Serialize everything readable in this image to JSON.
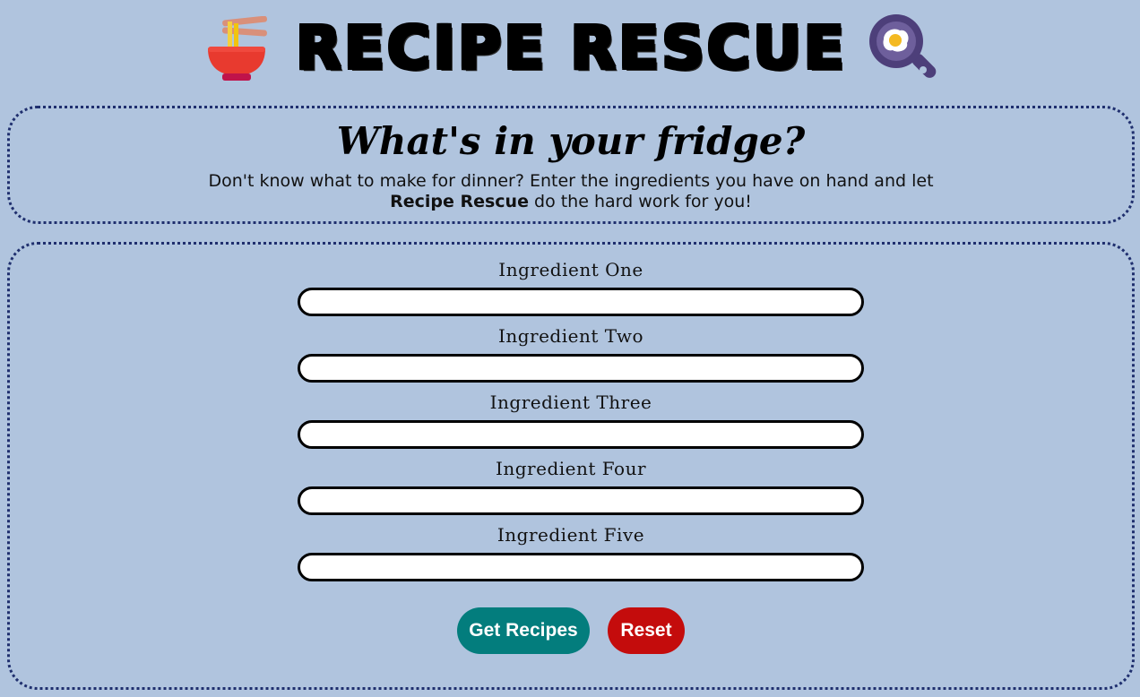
{
  "header": {
    "title": "RECIPE RESCUE",
    "left_icon": "noodle-bowl-icon",
    "right_icon": "frying-pan-egg-icon"
  },
  "intro": {
    "heading": "What's in your fridge?",
    "text_before": "Don't know what to make for dinner? Enter the ingredients you have on hand and let ",
    "brand": "Recipe Rescue",
    "text_after": " do the hard work for you!"
  },
  "form": {
    "fields": [
      {
        "label": "Ingredient One",
        "value": ""
      },
      {
        "label": "Ingredient Two",
        "value": ""
      },
      {
        "label": "Ingredient Three",
        "value": ""
      },
      {
        "label": "Ingredient Four",
        "value": ""
      },
      {
        "label": "Ingredient Five",
        "value": ""
      }
    ],
    "submit_label": "Get Recipes",
    "reset_label": "Reset"
  },
  "colors": {
    "background": "#b0c4de",
    "border": "#1f2f6e",
    "submit": "#037d7d",
    "reset": "#c40c0c"
  }
}
